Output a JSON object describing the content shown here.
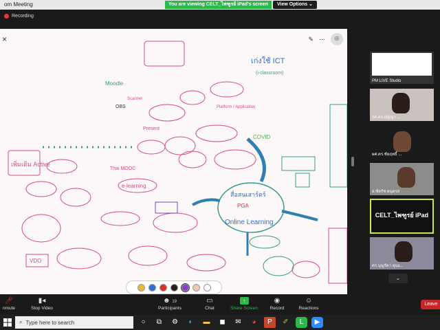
{
  "window": {
    "title": "om Meeting"
  },
  "share_banner": {
    "message": "You are viewing CELT_ไพฑูรย์ iPad's screen",
    "options_label": "View Options ⌄"
  },
  "recording": {
    "label": "Recording"
  },
  "board": {
    "close": "×"
  },
  "mindmap": {
    "center": {
      "line1": "สื่อสนเสาร์ตร์",
      "line2": "PGA",
      "line3": "Online Learning"
    },
    "labels": {
      "ict": "เก่งใช้ ICT",
      "iclassroom": "(i-classroom)",
      "moodle": "Moodle",
      "platform": "Platform / Application",
      "covid": "COVID",
      "active": "เพิ่มเติม Active",
      "thai_mooc": "Thai MOOC",
      "elearning": "e-learning",
      "vdo": "VDO",
      "obs": "OBS",
      "scanner": "Scanner",
      "present": "Present",
      "online_learning": "Online Learning"
    }
  },
  "palette": {
    "colors": [
      "#e8b93a",
      "#2f6fd0",
      "#d93030",
      "#222222",
      "#8a3fcf",
      "#f3c6b0",
      "#ffffff"
    ]
  },
  "participants_panel": {
    "tiles": [
      {
        "name": "PM LIVE Studio"
      },
      {
        "name": "รศ.ดร.ณัฐญา ..."
      },
      {
        "name": "ผศ.ดร.ชัยฤทธิ์ ..."
      },
      {
        "name": "อ.ชัยรัช ผนุดรส"
      },
      {
        "name": "CELT_ไพฑูรย์ iPad"
      },
      {
        "name": "ดร.บุญรัตา ยุนง..."
      }
    ]
  },
  "toolbar": {
    "unmute": "nmute",
    "stop_video": "Stop Video",
    "participants": "Participants",
    "participants_count": "19",
    "chat": "Chat",
    "share_screen": "Share Screen",
    "record": "Record",
    "reactions": "Reactions",
    "leave": "Leave"
  },
  "taskbar": {
    "search_placeholder": "Type here to search"
  },
  "colors": {
    "share_green": "#2db84b",
    "leave_red": "#c62828",
    "active_border": "#c9e84b"
  }
}
